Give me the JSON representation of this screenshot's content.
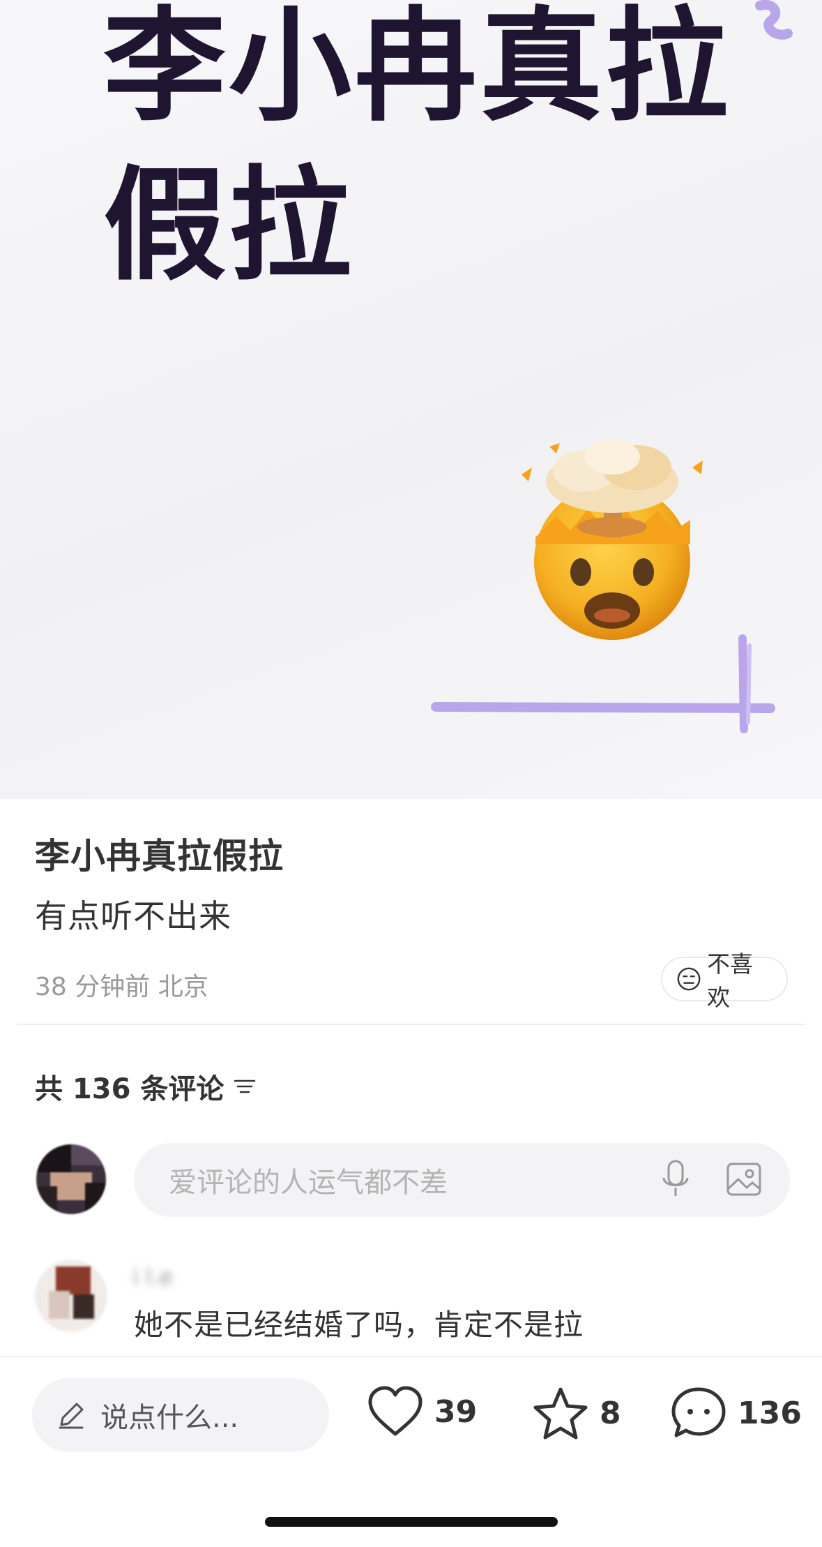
{
  "cover": {
    "title": "李小冉真拉假拉"
  },
  "post": {
    "title": "李小冉真拉假拉",
    "body": "有点听不出来",
    "time": "38 分钟前",
    "location": "北京",
    "dislike_label": "不喜欢"
  },
  "comments": {
    "count_label": "共 136 条评论",
    "input_placeholder": "爱评论的人运气都不差",
    "items": [
      {
        "user": "i l.e",
        "text": "她不是已经结婚了吗，肯定不是拉"
      }
    ]
  },
  "bottom_bar": {
    "say_placeholder": "说点什么...",
    "likes": "39",
    "stars": "8",
    "comments": "136"
  },
  "colors": {
    "cover_title": "#1f1530",
    "accent_purple": "#b9a6ea"
  }
}
